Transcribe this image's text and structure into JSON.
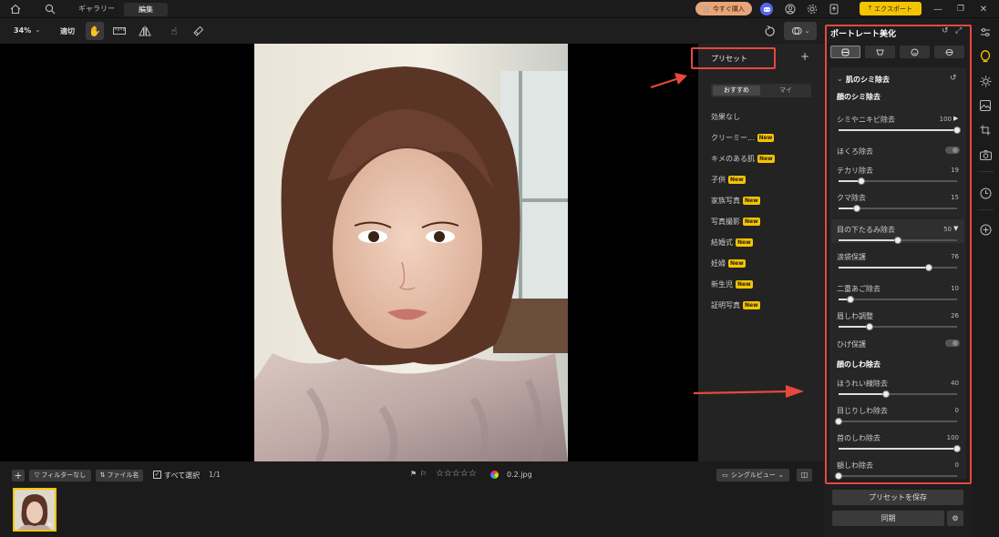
{
  "topbar": {
    "gallery_label": "ギャラリー",
    "edit_label": "編集",
    "buy_label": "今すぐ購入",
    "export_label": "エクスポート"
  },
  "toolbar": {
    "zoom": "34%",
    "fit_label": "適切"
  },
  "presets": {
    "title": "プリセット",
    "tab_recommended": "おすすめ",
    "tab_mine": "マイ",
    "new_badge": "New",
    "items": [
      {
        "label": "効果なし",
        "new": false
      },
      {
        "label": "クリーミー...",
        "new": true
      },
      {
        "label": "キメのある肌",
        "new": true
      },
      {
        "label": "子供",
        "new": true
      },
      {
        "label": "家族写真",
        "new": true
      },
      {
        "label": "写真撮影",
        "new": true
      },
      {
        "label": "結婚式",
        "new": true
      },
      {
        "label": "妊婦",
        "new": true
      },
      {
        "label": "新生児",
        "new": true
      },
      {
        "label": "証明写真",
        "new": true
      }
    ]
  },
  "panel": {
    "title": "ポートレート美化",
    "section_skin": "肌のシミ除去",
    "group_face_spots": "顔のシミ除去",
    "group_face_wrinkles": "顔のしわ除去",
    "sliders": [
      {
        "label": "シミやニキビ除去",
        "value": "100",
        "pct": 1.0
      },
      {
        "label": "テカリ除去",
        "value": "19",
        "pct": 0.19
      },
      {
        "label": "クマ除去",
        "value": "15",
        "pct": 0.15
      },
      {
        "label": "目の下たるみ除去",
        "value": "50",
        "pct": 0.5
      },
      {
        "label": "涙袋保護",
        "value": "76",
        "pct": 0.76
      },
      {
        "label": "二重あご除去",
        "value": "10",
        "pct": 0.1
      },
      {
        "label": "眉しわ調整",
        "value": "26",
        "pct": 0.26
      },
      {
        "label": "ほうれい線除去",
        "value": "40",
        "pct": 0.4
      },
      {
        "label": "目じりしわ除去",
        "value": "0",
        "pct": 0.0
      },
      {
        "label": "首のしわ除去",
        "value": "100",
        "pct": 1.0
      },
      {
        "label": "額しわ除去",
        "value": "0",
        "pct": 0.0
      }
    ],
    "toggles": [
      {
        "label": "ほくろ除去"
      },
      {
        "label": "ひげ保護"
      }
    ],
    "save_preset_label": "プリセットを保存",
    "sync_label": "同期"
  },
  "bottom": {
    "filter_label": "フィルターなし",
    "filename_label": "ファイル名",
    "select_all_label": "すべて選択",
    "count": "1/1",
    "filename": "0.2.jpg",
    "view_label": "シングルビュー"
  },
  "colors": {
    "accent": "#f5c400",
    "highlight": "#e5493c"
  }
}
